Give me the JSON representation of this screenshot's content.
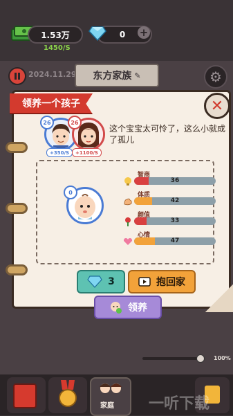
{
  "hud": {
    "money": "1.53万",
    "money_rate": "1450/S",
    "gems": "0",
    "add_label": "+"
  },
  "family": {
    "date": "2024.11.29",
    "name": "东方家族"
  },
  "dialog": {
    "title": "领养一个孩子",
    "message": "这个宝宝太可怜了，这么小就成了孤儿",
    "father": {
      "level": "26",
      "rate": "+350/S"
    },
    "mother": {
      "level": "26",
      "rate": "+1100/S"
    },
    "baby": {
      "level": "0"
    },
    "stats": [
      {
        "label": "智商",
        "value": "36",
        "fraction": 0.18,
        "color": "#d94040",
        "icon": "bulb-icon"
      },
      {
        "label": "体质",
        "value": "42",
        "fraction": 0.22,
        "color": "#f2a23a",
        "icon": "muscle-icon"
      },
      {
        "label": "颜值",
        "value": "33",
        "fraction": 0.15,
        "color": "#d94040",
        "icon": "rose-icon"
      },
      {
        "label": "心情",
        "value": "47",
        "fraction": 0.25,
        "color": "#f2a23a",
        "icon": "heart-icon"
      }
    ],
    "buttons": {
      "gem_cost": "3",
      "take_home": "抱回家",
      "adopt": "领养"
    }
  },
  "bottom": {
    "zoom": "100%",
    "active_tab": "家庭",
    "watermark": "一听下载"
  },
  "colors": {
    "accent_red": "#d33a2e",
    "gem": "#5ec2b2",
    "orange": "#f2a23a",
    "purple": "#a68ad8"
  }
}
